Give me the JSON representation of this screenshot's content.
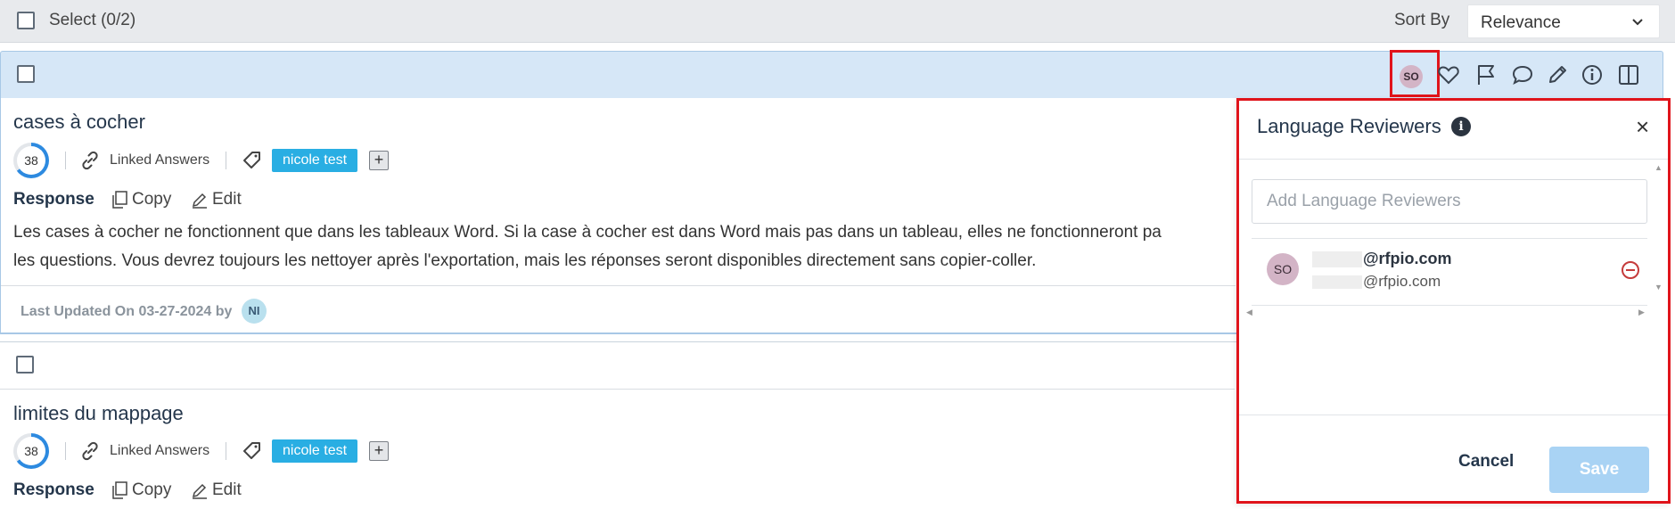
{
  "header": {
    "select_label": "Select (0/2)",
    "sort_label": "Sort By",
    "sort_value": "Relevance"
  },
  "toolbar": {
    "avatar_initials": "SO",
    "icons": [
      "heart-icon",
      "flag-icon",
      "comment-icon",
      "pencil-icon",
      "info-icon",
      "columns-icon"
    ]
  },
  "cards": [
    {
      "title": "cases à cocher",
      "score": "38",
      "linked_answers": "Linked Answers",
      "tag": "nicole test",
      "plus": "+",
      "response_label": "Response",
      "copy_label": "Copy",
      "edit_label": "Edit",
      "body_line1": "Les cases à cocher ne fonctionnent que dans les tableaux Word. Si la case à cocher est dans Word mais pas dans un tableau, elles ne fonctionneront pa",
      "body_line2": "les questions. Vous devrez toujours les nettoyer après l'exportation, mais les réponses seront disponibles directement sans copier-coller.",
      "last_updated": "Last Updated On 03-27-2024 by",
      "updated_by": "NI"
    },
    {
      "title": "limites du mappage",
      "score": "38",
      "linked_answers": "Linked Answers",
      "tag": "nicole test",
      "plus": "+",
      "response_label": "Response",
      "copy_label": "Copy",
      "edit_label": "Edit"
    }
  ],
  "panel": {
    "title": "Language Reviewers",
    "info": "i",
    "close": "×",
    "input_placeholder": "Add Language Reviewers",
    "reviewer": {
      "initials": "SO",
      "email_domain": "@rfpio.com",
      "email_sub_domain": "@rfpio.com"
    },
    "cancel_label": "Cancel",
    "save_label": "Save"
  },
  "colors": {
    "accent": "#29aee3",
    "highlight_red": "#e0141b",
    "header_blue": "#d6e7f7",
    "save_disabled": "#a9d3f4"
  }
}
